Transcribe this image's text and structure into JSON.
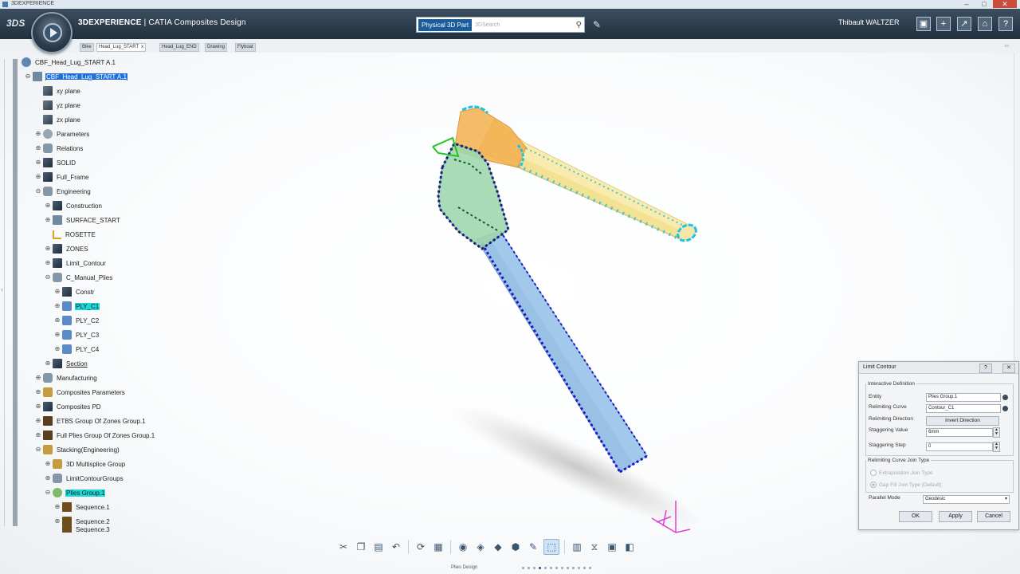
{
  "window": {
    "title": "3DEXPERIENCE"
  },
  "header": {
    "logo": "3DS",
    "app_brand": "3DEXPERIENCE",
    "app_name": "CATIA Composites Design",
    "search": {
      "scope": "Physical 3D Part",
      "placeholder": "3DSearch"
    },
    "user": "Thibault WALTZER"
  },
  "tabs": {
    "items": [
      "Bike",
      "Head_Lug_START",
      "Head_Lug_END",
      "Drawing",
      "Flyboat"
    ],
    "active_index": 1
  },
  "tree": {
    "root": "CBF_Head_Lug_START A.1",
    "part": "CBF_Head_Lug_START A.1",
    "items": [
      {
        "label": "xy plane"
      },
      {
        "label": "yz plane"
      },
      {
        "label": "zx plane"
      },
      {
        "label": "Parameters"
      },
      {
        "label": "Relations"
      },
      {
        "label": "SOLID"
      },
      {
        "label": "Full_Frame"
      },
      {
        "label": "Engineering"
      },
      {
        "label": "Construction"
      },
      {
        "label": "SURFACE_START"
      },
      {
        "label": "ROSETTE"
      },
      {
        "label": "ZONES"
      },
      {
        "label": "Limit_Contour"
      },
      {
        "label": "C_Manual_Plies"
      },
      {
        "label": "Constr"
      },
      {
        "label": "PLY_C1"
      },
      {
        "label": "PLY_C2"
      },
      {
        "label": "PLY_C3"
      },
      {
        "label": "PLY_C4"
      },
      {
        "label": "Section"
      },
      {
        "label": "Manufacturing"
      },
      {
        "label": "Composites Parameters"
      },
      {
        "label": "Composites PD"
      },
      {
        "label": "ETBS Group Of Zones Group.1"
      },
      {
        "label": "Full Plies Group Of Zones Group.1"
      },
      {
        "label": "Stacking(Engineering)"
      },
      {
        "label": "3D Multisplice Group"
      },
      {
        "label": "LimitContourGroups"
      },
      {
        "label": "Plies Group.1"
      },
      {
        "label": "Sequence.1"
      },
      {
        "label": "Sequence.2"
      },
      {
        "label": "Sequence.3"
      }
    ]
  },
  "dialog": {
    "title": "Limit Contour",
    "group_interactive": "Interactive Definition",
    "entity_label": "Entity",
    "entity_value": "Plies Group.1",
    "relimiting_curve_label": "Relimiting Curve",
    "relimiting_curve_value": "Contour_C1",
    "relimiting_direction_label": "Relimiting Direction",
    "invert_direction": "Invert Direction",
    "staggering_value_label": "Staggering Value",
    "staggering_value": "6mm",
    "staggering_step_label": "Staggering Step",
    "staggering_step": "0",
    "group_join": "Relimiting Curve Join Type",
    "join_option_1": "Extrapolation Join Type",
    "join_option_2": "Gap Fill Join Type (Default)",
    "parallel_mode_label": "Parallel Mode",
    "parallel_mode_value": "Geodesic",
    "ok": "OK",
    "apply": "Apply",
    "cancel": "Cancel"
  },
  "bottom": {
    "section": "Plies Design"
  },
  "colors": {
    "selection_blue": "#1f6fd6",
    "selection_cyan": "#1fd6d6",
    "tube_yellow": "#f4e38c",
    "tube_blue": "#7fb0dc",
    "lug_green": "#8fd0a0"
  }
}
